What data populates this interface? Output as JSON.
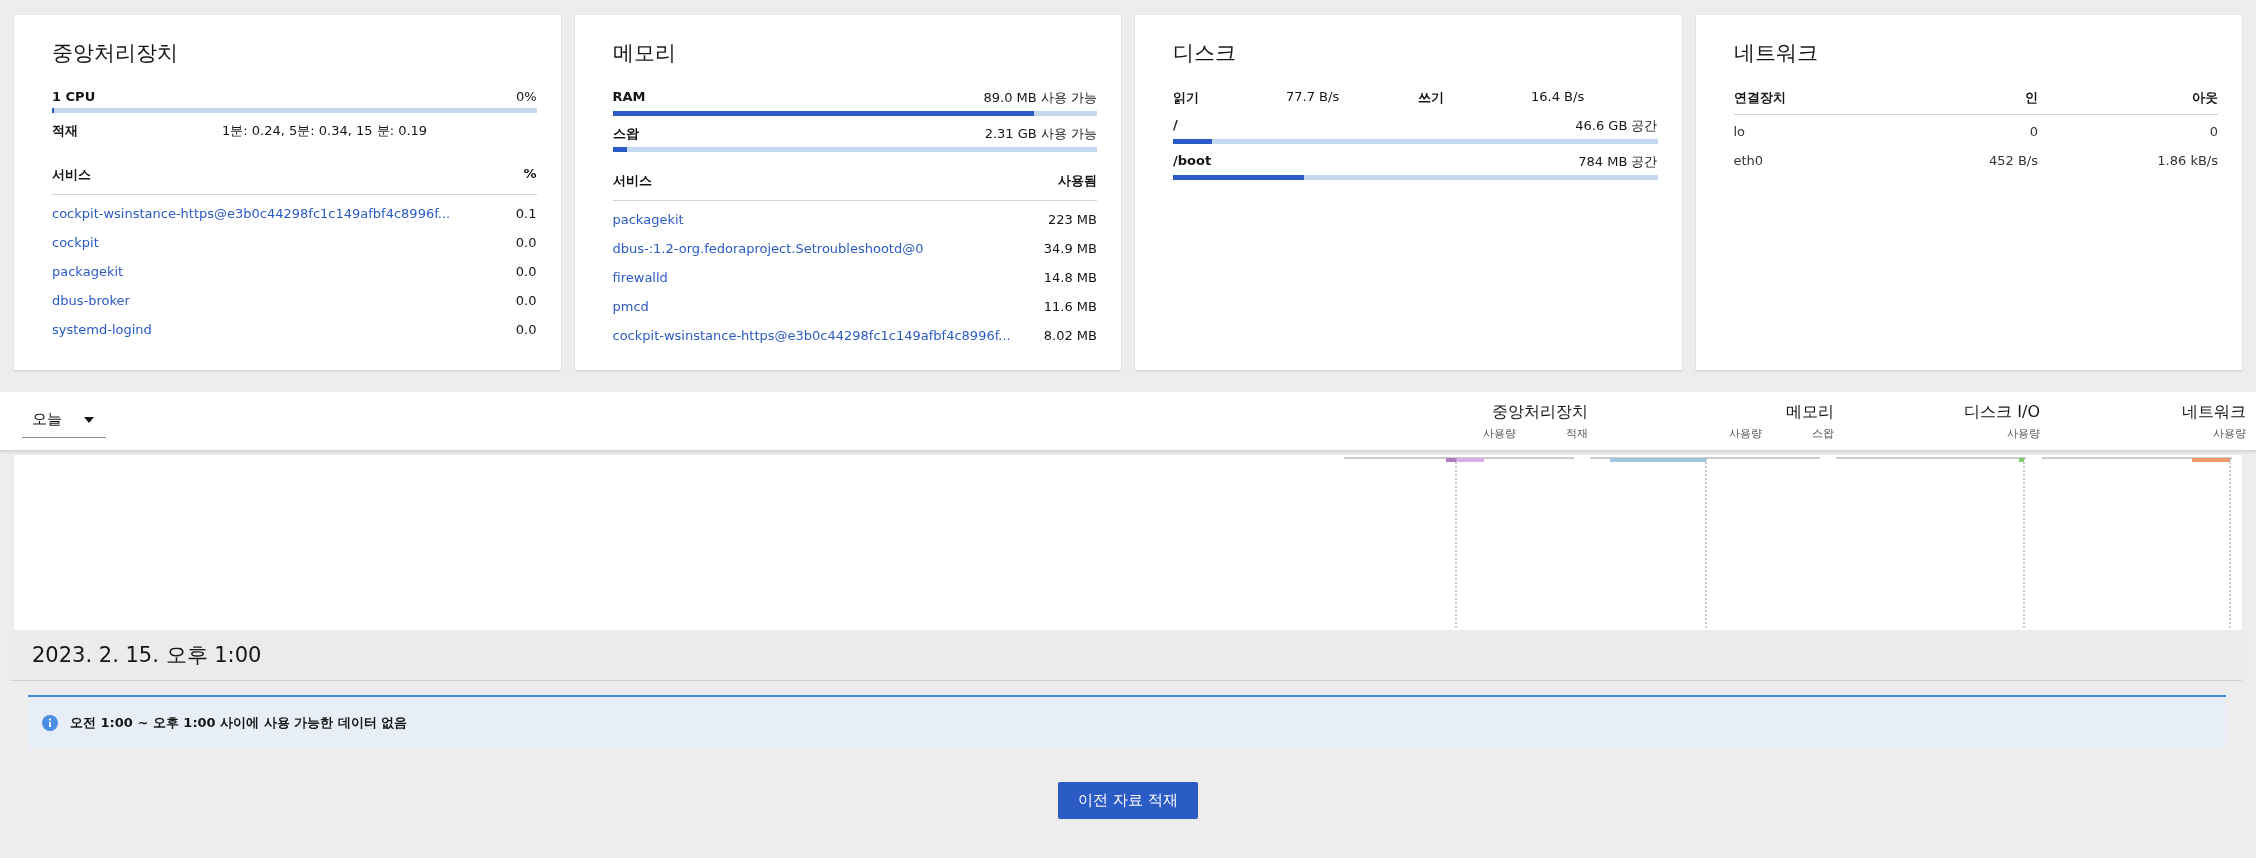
{
  "cpu_card": {
    "title": "중앙처리장치",
    "meter": {
      "label": "1 CPU",
      "value": "0%",
      "level": 0
    },
    "load": {
      "label": "적재",
      "value": "1분: 0.24, 5분: 0.34, 15 분: 0.19"
    },
    "services": {
      "columns": [
        "서비스",
        "%"
      ],
      "rows": [
        {
          "name": "cockpit-wsinstance-https@e3b0c44298fc1c149afbf4c8996f...",
          "value": "0.1"
        },
        {
          "name": "cockpit",
          "value": "0.0"
        },
        {
          "name": "packagekit",
          "value": "0.0"
        },
        {
          "name": "dbus-broker",
          "value": "0.0"
        },
        {
          "name": "systemd-logind",
          "value": "0.0"
        }
      ]
    }
  },
  "memory_card": {
    "title": "메모리",
    "meters": [
      {
        "label": "RAM",
        "value": "89.0 MB 사용 가능",
        "level": 0.87
      },
      {
        "label": "스왑",
        "value": "2.31 GB 사용 가능",
        "level": 0.03
      }
    ],
    "services": {
      "columns": [
        "서비스",
        "사용됨"
      ],
      "rows": [
        {
          "name": "packagekit",
          "value": "223 MB"
        },
        {
          "name": "dbus-:1.2-org.fedoraproject.Setroubleshootd@0",
          "value": "34.9 MB"
        },
        {
          "name": "firewalld",
          "value": "14.8 MB"
        },
        {
          "name": "pmcd",
          "value": "11.6 MB"
        },
        {
          "name": "cockpit-wsinstance-https@e3b0c44298fc1c149afbf4c8996f...",
          "value": "8.02 MB"
        }
      ]
    }
  },
  "disk_card": {
    "title": "디스크",
    "io": [
      {
        "label": "읽기",
        "value": "77.7 B/s"
      },
      {
        "label": "쓰기",
        "value": "16.4 B/s"
      }
    ],
    "mounts": [
      {
        "label": "/",
        "value": "46.6 GB 공간",
        "level": 0.08
      },
      {
        "label": "/boot",
        "value": "784 MB 공간",
        "level": 0.27
      }
    ]
  },
  "network_card": {
    "title": "네트워크",
    "columns": [
      "연결장치",
      "인",
      "아웃"
    ],
    "rows": [
      {
        "name": "lo",
        "in": "0",
        "out": "0"
      },
      {
        "name": "eth0",
        "in": "452 B/s",
        "out": "1.86 kB/s"
      }
    ]
  },
  "timeline": {
    "range": "오늘",
    "groups": [
      {
        "title": "중앙처리장치",
        "sublabels": [
          "사용량",
          "적재"
        ]
      },
      {
        "title": "메모리",
        "sublabels": [
          "사용량",
          "스왑"
        ]
      },
      {
        "title": "디스크 I/O",
        "sublabels": [
          "사용량"
        ]
      },
      {
        "title": "네트워크",
        "sublabels": [
          "사용량"
        ]
      }
    ]
  },
  "hour": {
    "heading": "2023. 2. 15. 오후 1:00",
    "alert": "오전 1:00 ~ 오후 1:00 사이에 사용 가능한 데이터 없음",
    "button": "이전 자료 적재"
  }
}
